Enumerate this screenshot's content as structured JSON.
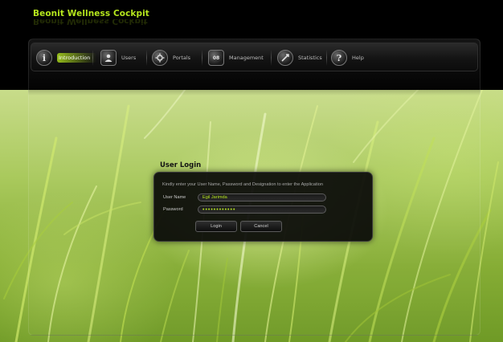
{
  "app": {
    "title": "Beonit Wellness Cockpit"
  },
  "nav": {
    "items": [
      {
        "label": "Introduction",
        "icon": "info-icon",
        "glyph": "i",
        "active": true
      },
      {
        "label": "Users",
        "icon": "users-icon",
        "glyph": "",
        "active": false
      },
      {
        "label": "Portals",
        "icon": "portals-icon",
        "glyph": "",
        "active": false
      },
      {
        "label": "Management",
        "icon": "calendar-icon",
        "glyph": "08",
        "active": false
      },
      {
        "label": "Statistics",
        "icon": "statistics-icon",
        "glyph": "",
        "active": false
      },
      {
        "label": "Help",
        "icon": "help-icon",
        "glyph": "?",
        "active": false
      }
    ]
  },
  "login": {
    "title": "User Login",
    "instructions": "Kindly enter your User Name, Password and Designation to enter the Application",
    "username_label": "User Name",
    "username_value": "Egil Jarimda",
    "password_label": "Password",
    "password_value": "••••••••••••",
    "login_button": "Login",
    "cancel_button": "Cancel"
  },
  "colors": {
    "accent": "#b5e61d",
    "header_bg": "#000000",
    "panel_bg": "#080808"
  }
}
